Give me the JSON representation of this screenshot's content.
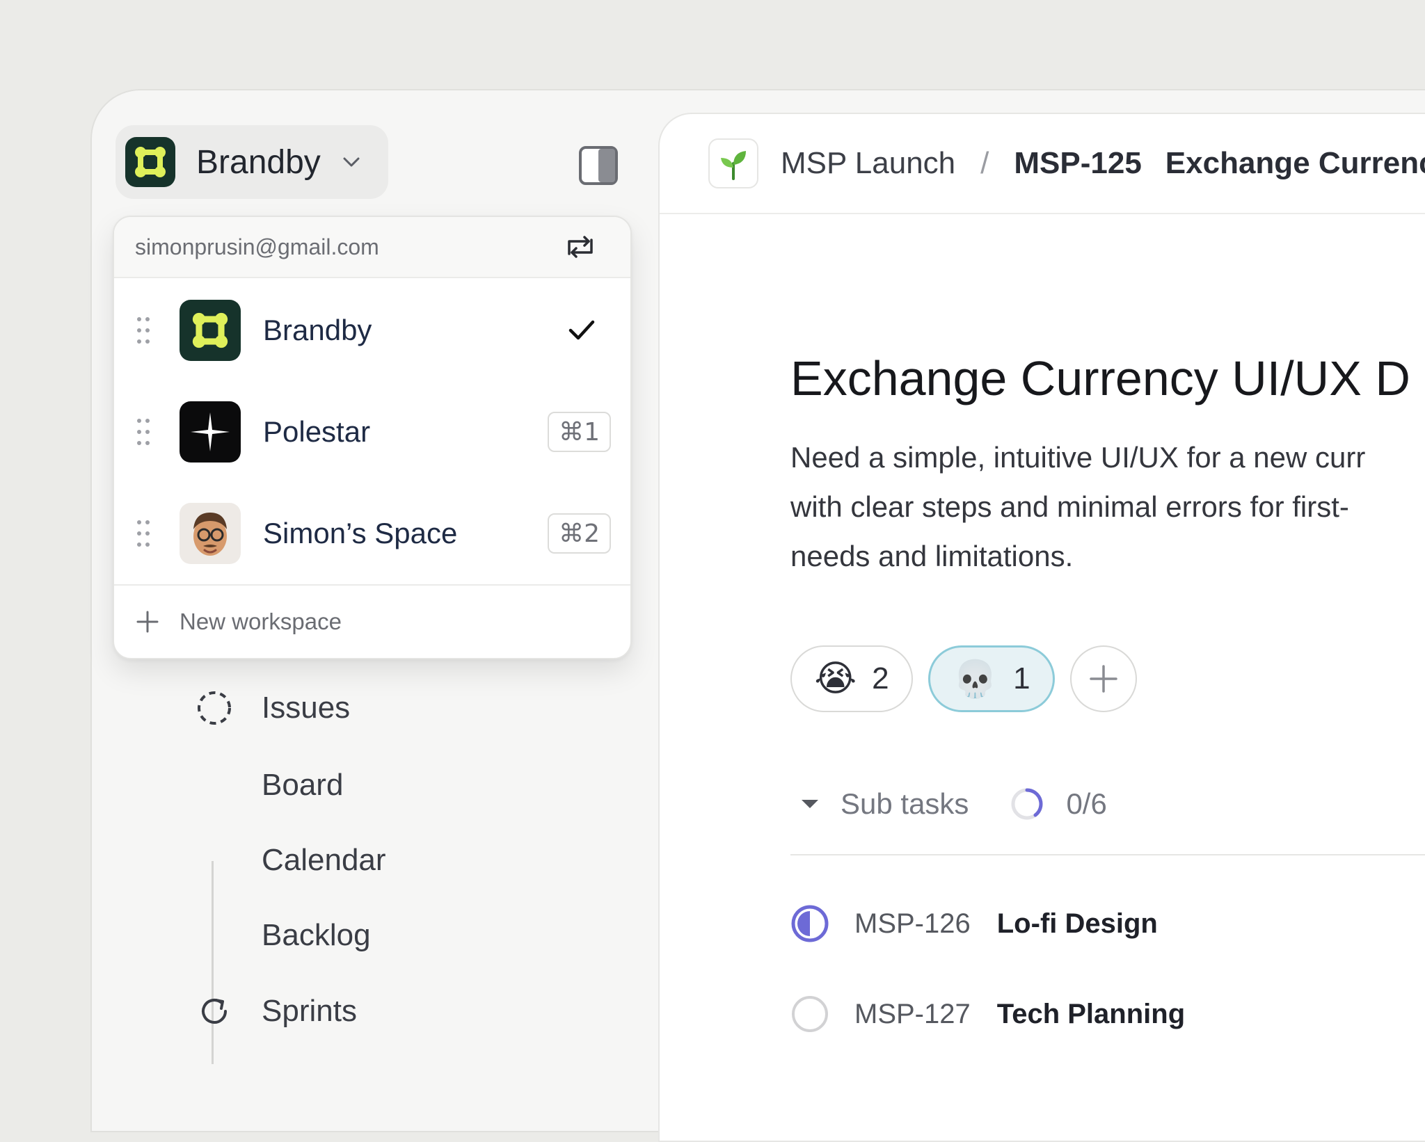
{
  "sidebar": {
    "workspace_name": "Brandby",
    "nav": {
      "issues": "Issues",
      "board": "Board",
      "calendar": "Calendar",
      "backlog": "Backlog",
      "sprints": "Sprints"
    }
  },
  "dropdown": {
    "email": "simonprusin@gmail.com",
    "workspaces": [
      {
        "name": "Brandby",
        "selected": true,
        "shortcut": ""
      },
      {
        "name": "Polestar",
        "selected": false,
        "shortcut": "⌘1"
      },
      {
        "name": "Simon’s Space",
        "selected": false,
        "shortcut": "⌘2"
      }
    ],
    "new_workspace": "New workspace"
  },
  "main": {
    "breadcrumb": {
      "project": "MSP Launch",
      "separator": "/",
      "issue_id": "MSP-125",
      "issue_title": "Exchange Currenc"
    },
    "title": "Exchange Currency UI/UX D",
    "description": "Need a simple, intuitive UI/UX for a new curr\nwith clear steps and minimal errors for first-\nneeds and limitations.",
    "reactions": [
      {
        "emoji": "😭",
        "count": "2",
        "active": false
      },
      {
        "emoji": "💀",
        "count": "1",
        "active": true
      }
    ],
    "subtasks": {
      "label": "Sub tasks",
      "progress": "0/6",
      "items": [
        {
          "id": "MSP-126",
          "title": "Lo-fi Design",
          "status": "in-progress"
        },
        {
          "id": "MSP-127",
          "title": "Tech Planning",
          "status": "todo"
        }
      ]
    }
  },
  "colors": {
    "accent_purple": "#6d6ad6",
    "reaction_active_border": "#8ccbd9",
    "brand_dark": "#16332b",
    "brand_yellow": "#dff05a"
  }
}
